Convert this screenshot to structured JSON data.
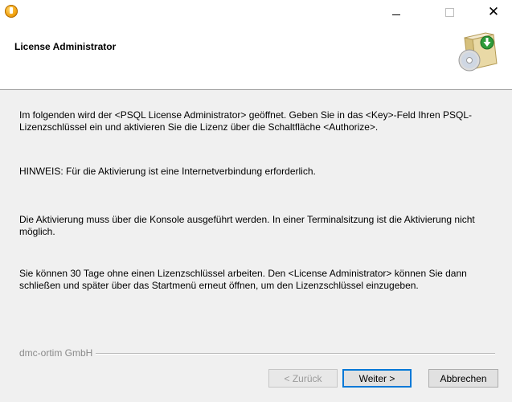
{
  "titlebar": {
    "icons": [
      "app-icon",
      "minimize-icon",
      "maximize-icon",
      "close-icon"
    ],
    "close_glyph": "✕"
  },
  "header": {
    "title": "License Administrator",
    "graphic_icon": "install-cd-icon"
  },
  "content": {
    "p1": "Im folgenden wird der <PSQL License Administrator> geöffnet. Geben Sie in das <Key>-Feld Ihren PSQL-Lizenzschlüssel ein und aktivieren Sie die Lizenz über die Schaltfläche <Authorize>.",
    "p2": "HINWEIS: Für die Aktivierung ist eine Internetverbindung erforderlich.",
    "p3": "Die Aktivierung muss über die Konsole ausgeführt werden. In einer Terminalsitzung ist die Aktivierung nicht möglich.",
    "p4": "Sie können 30 Tage ohne einen Lizenzschlüssel arbeiten. Den <License Administrator> können Sie dann schließen und später über das Startmenü erneut öffnen, um den Lizenzschlüssel einzugeben."
  },
  "footer": {
    "brand": "dmc-ortim GmbH",
    "back_label": "< Zurück",
    "next_label": "Weiter >",
    "cancel_label": "Abbrechen"
  },
  "colors": {
    "accent": "#0078d7",
    "dialog_bg": "#f0f0f0",
    "header_bg": "#ffffff",
    "disabled_text": "#9a9a9a"
  }
}
